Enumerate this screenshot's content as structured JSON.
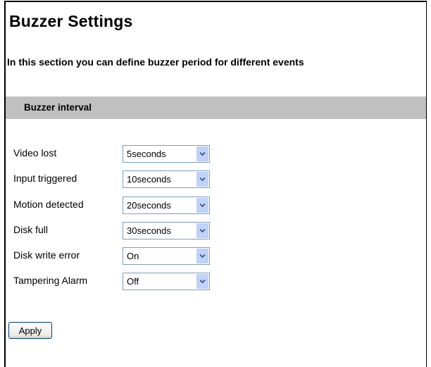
{
  "page": {
    "title": "Buzzer Settings",
    "description": "In this section you can define buzzer period for different events"
  },
  "section": {
    "title": "Buzzer interval"
  },
  "settings": [
    {
      "label": "Video lost",
      "value": "5seconds"
    },
    {
      "label": "Input triggered",
      "value": "10seconds"
    },
    {
      "label": "Motion detected",
      "value": "20seconds"
    },
    {
      "label": "Disk full",
      "value": "30seconds"
    },
    {
      "label": "Disk write error",
      "value": "On"
    },
    {
      "label": "Tampering Alarm",
      "value": "Off"
    }
  ],
  "actions": {
    "apply_label": "Apply"
  },
  "icons": {
    "dropdown": "chevron-down-icon"
  },
  "colors": {
    "section_bar": "#c0c0c0",
    "select_border": "#7f9db9",
    "select_arrow_bg": "#c1d3fb",
    "button_border": "#003c74"
  }
}
